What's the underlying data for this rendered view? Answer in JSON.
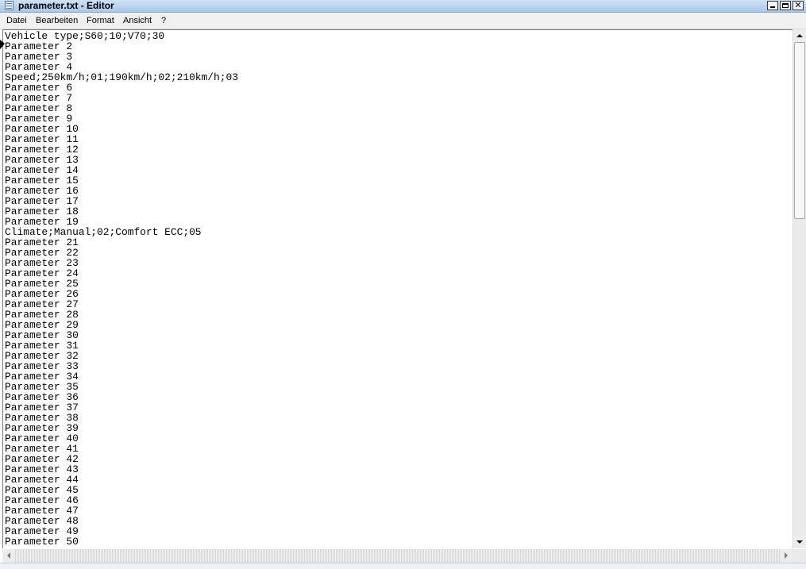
{
  "window": {
    "title": "parameter.txt - Editor"
  },
  "menu": [
    "Datei",
    "Bearbeiten",
    "Format",
    "Ansicht",
    "?"
  ],
  "editor": {
    "lines": [
      "Vehicle type;S60;10;V70;30",
      "Parameter 2",
      "Parameter 3",
      "Parameter 4",
      "Speed;250km/h;01;190km/h;02;210km/h;03",
      "Parameter 6",
      "Parameter 7",
      "Parameter 8",
      "Parameter 9",
      "Parameter 10",
      "Parameter 11",
      "Parameter 12",
      "Parameter 13",
      "Parameter 14",
      "Parameter 15",
      "Parameter 16",
      "Parameter 17",
      "Parameter 18",
      "Parameter 19",
      "Climate;Manual;02;Comfort ECC;05",
      "Parameter 21",
      "Parameter 22",
      "Parameter 23",
      "Parameter 24",
      "Parameter 25",
      "Parameter 26",
      "Parameter 27",
      "Parameter 28",
      "Parameter 29",
      "Parameter 30",
      "Parameter 31",
      "Parameter 32",
      "Parameter 33",
      "Parameter 34",
      "Parameter 35",
      "Parameter 36",
      "Parameter 37",
      "Parameter 38",
      "Parameter 39",
      "Parameter 40",
      "Parameter 41",
      "Parameter 42",
      "Parameter 43",
      "Parameter 44",
      "Parameter 45",
      "Parameter 46",
      "Parameter 47",
      "Parameter 48",
      "Parameter 49",
      "Parameter 50"
    ]
  },
  "icons": {
    "app": "notepad-icon",
    "minimize": "minimize-icon",
    "maximize": "maximize-icon",
    "close": "close-icon",
    "scroll_up": "scroll-up-arrow-icon",
    "scroll_down": "scroll-down-arrow-icon",
    "scroll_left": "scroll-left-arrow-icon",
    "scroll_right": "scroll-right-arrow-icon",
    "pointer": "mouse-pointer-icon"
  },
  "colors": {
    "titlebar": "#b9d3ee",
    "menubar": "#f0f0f0",
    "text": "#000000",
    "editor_bg": "#ffffff"
  }
}
